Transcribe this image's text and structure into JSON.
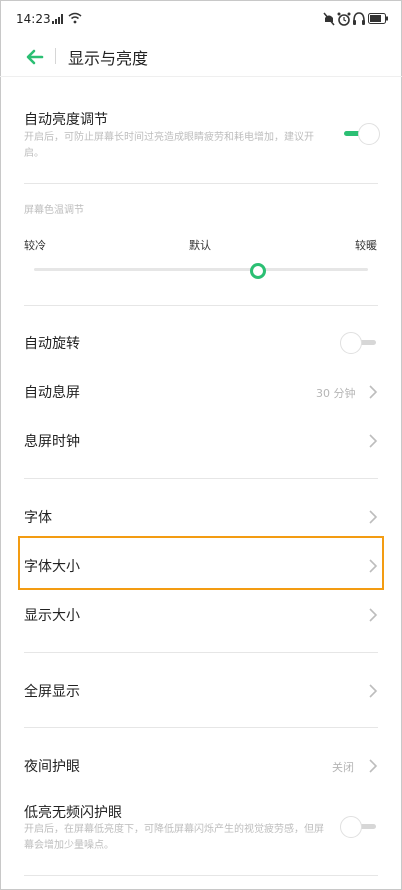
{
  "status_bar": {
    "time": "14:23",
    "icons": [
      "signal-icon",
      "wifi-icon",
      "mute-icon",
      "alarm-icon",
      "headphones-icon",
      "battery-icon"
    ]
  },
  "header": {
    "title": "显示与亮度",
    "back_icon": "back-arrow-icon"
  },
  "auto_brightness": {
    "label": "自动亮度调节",
    "description": "开启后，可防止屏幕长时间过亮造成眼睛疲劳和耗电增加，建议开启。",
    "enabled": true
  },
  "color_temp": {
    "section_label": "屏幕色温调节",
    "left": "较冷",
    "center": "默认",
    "right": "较暖",
    "level": 0.67
  },
  "rows": {
    "auto_rotate": {
      "label": "自动旋转",
      "enabled": false
    },
    "auto_screen_off": {
      "label": "自动息屏",
      "value": "30 分钟"
    },
    "screen_off_clock": {
      "label": "息屏时钟"
    },
    "font": {
      "label": "字体"
    },
    "font_size": {
      "label": "字体大小"
    },
    "display_size": {
      "label": "显示大小"
    },
    "full_screen": {
      "label": "全屏显示"
    },
    "night_mode": {
      "label": "夜间护眼",
      "value": "关闭"
    },
    "low_flicker": {
      "label": "低亮无频闪护眼",
      "description": "开启后，在屏幕低亮度下，可降低屏幕闪烁产生的视觉疲劳感，但屏幕会增加少量噪点。",
      "enabled": false
    }
  },
  "colors": {
    "accent": "#2bbf73",
    "highlight": "#f39c12"
  }
}
